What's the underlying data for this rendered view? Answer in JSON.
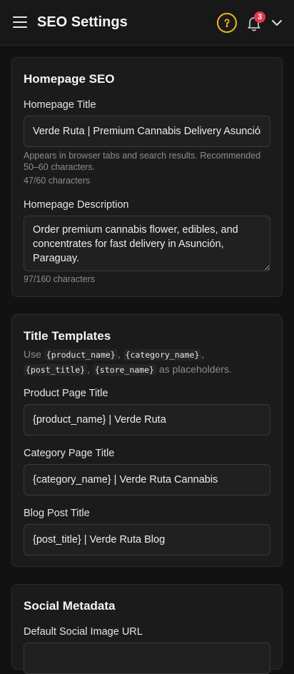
{
  "header": {
    "title": "SEO Settings",
    "notification_count": "3",
    "accent_color": "#f0b429",
    "badge_color": "#e0394b",
    "icons": [
      "menu-icon",
      "help-icon",
      "bell-icon",
      "chevron-down-icon"
    ]
  },
  "homepage": {
    "title": "Homepage SEO",
    "title_label": "Homepage Title",
    "title_value": "Verde Ruta | Premium Cannabis Delivery Asunción",
    "title_hint": "Appears in browser tabs and search results. Recommended 50–60 characters.",
    "title_count": "47/60 characters",
    "description_label": "Homepage Description",
    "description_value": "Order premium cannabis flower, edibles, and concentrates for fast delivery in Asunción, Paraguay.",
    "description_count": "97/160 characters"
  },
  "templates": {
    "title": "Title Templates",
    "note_prefix": "Use",
    "placeholders": [
      "{product_name}",
      "{category_name}",
      "{post_title}",
      "{store_name}"
    ],
    "note_suffix": "as placeholders.",
    "product_label": "Product Page Title",
    "product_value": "{product_name} | Verde Ruta",
    "category_label": "Category Page Title",
    "category_value": "{category_name} | Verde Ruta Cannabis",
    "blog_label": "Blog Post Title",
    "blog_value": "{post_title} | Verde Ruta Blog"
  },
  "social": {
    "title": "Social Metadata",
    "image_label": "Default Social Image URL",
    "image_value": ""
  }
}
